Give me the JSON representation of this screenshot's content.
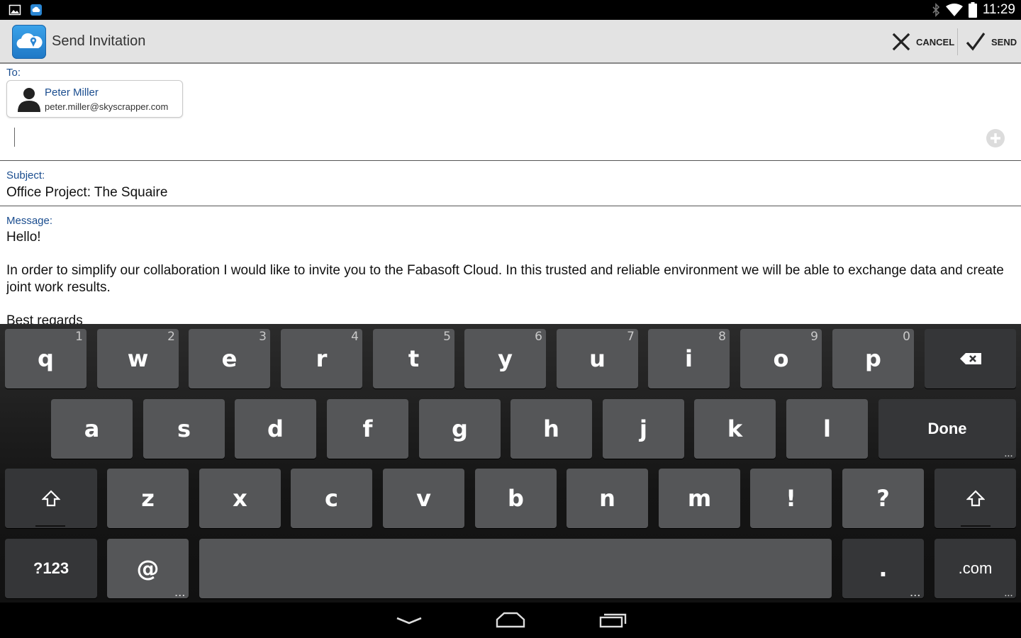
{
  "status_bar": {
    "time": "11:29",
    "left_icons": [
      "image-icon",
      "cloud-app-icon"
    ],
    "right_icons": [
      "bluetooth-icon",
      "wifi-icon",
      "battery-icon"
    ]
  },
  "action_bar": {
    "title": "Send Invitation",
    "cancel_label": "CANCEL",
    "send_label": "SEND"
  },
  "form": {
    "to_label": "To:",
    "recipient": {
      "name": "Peter Miller",
      "email": "peter.miller@skyscrapper.com"
    },
    "subject_label": "Subject:",
    "subject_value": "Office Project: The Squaire",
    "message_label": "Message:",
    "message_lines": [
      "Hello!",
      "",
      "In order to simplify our collaboration I would like to invite you to the Fabasoft Cloud. In this trusted and reliable environment we will be able to exchange data and create joint work results.",
      "",
      "Best regards"
    ]
  },
  "keyboard": {
    "row1": [
      {
        "label": "q",
        "hint": "1"
      },
      {
        "label": "w",
        "hint": "2"
      },
      {
        "label": "e",
        "hint": "3"
      },
      {
        "label": "r",
        "hint": "4"
      },
      {
        "label": "t",
        "hint": "5"
      },
      {
        "label": "y",
        "hint": "6"
      },
      {
        "label": "u",
        "hint": "7"
      },
      {
        "label": "i",
        "hint": "8"
      },
      {
        "label": "o",
        "hint": "9"
      },
      {
        "label": "p",
        "hint": "0"
      }
    ],
    "row2": [
      "a",
      "s",
      "d",
      "f",
      "g",
      "h",
      "j",
      "k",
      "l"
    ],
    "row3": [
      "z",
      "x",
      "c",
      "v",
      "b",
      "n",
      "m",
      "!",
      "?"
    ],
    "done_label": "Done",
    "symbols_label": "?123",
    "at_label": "@",
    "period_label": ".",
    "dotcom_label": ".com",
    "more_indicator": "..."
  },
  "colors": {
    "accent_text": "#1a4d8f",
    "key_face": "#555658",
    "key_dark": "#353638",
    "action_bar_bg": "#e3e3e3"
  }
}
